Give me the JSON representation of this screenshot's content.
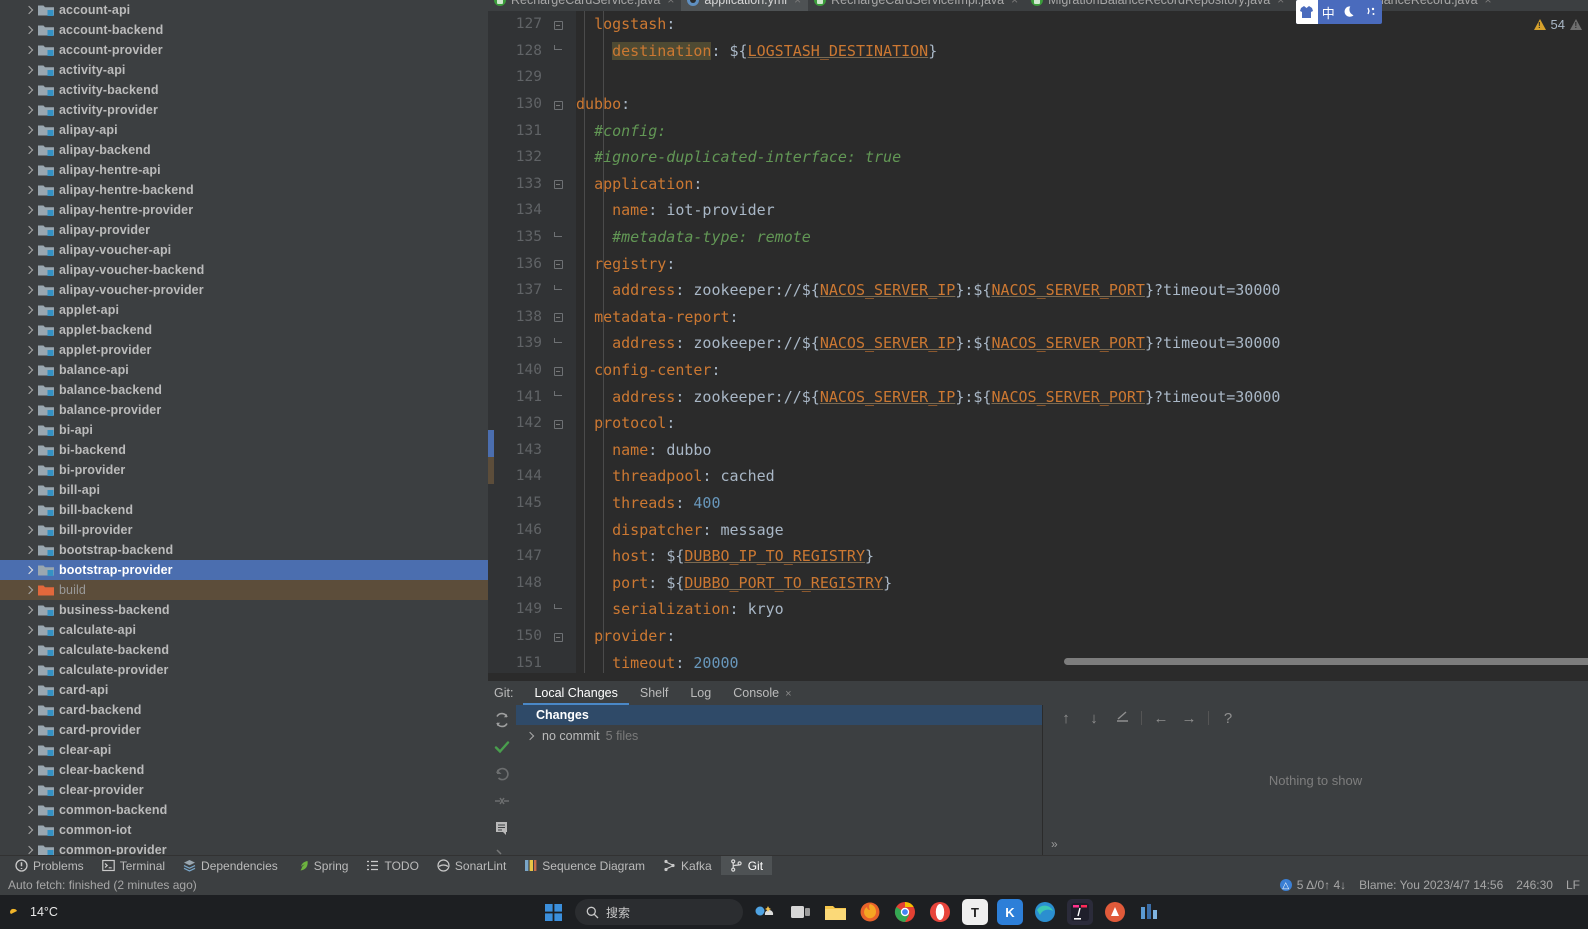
{
  "project_tree": {
    "items": [
      {
        "label": "account-api",
        "state": "normal"
      },
      {
        "label": "account-backend",
        "state": "normal"
      },
      {
        "label": "account-provider",
        "state": "normal"
      },
      {
        "label": "activity-api",
        "state": "normal"
      },
      {
        "label": "activity-backend",
        "state": "normal"
      },
      {
        "label": "activity-provider",
        "state": "normal"
      },
      {
        "label": "alipay-api",
        "state": "normal"
      },
      {
        "label": "alipay-backend",
        "state": "normal"
      },
      {
        "label": "alipay-hentre-api",
        "state": "normal"
      },
      {
        "label": "alipay-hentre-backend",
        "state": "normal"
      },
      {
        "label": "alipay-hentre-provider",
        "state": "normal"
      },
      {
        "label": "alipay-provider",
        "state": "normal"
      },
      {
        "label": "alipay-voucher-api",
        "state": "normal"
      },
      {
        "label": "alipay-voucher-backend",
        "state": "normal"
      },
      {
        "label": "alipay-voucher-provider",
        "state": "normal"
      },
      {
        "label": "applet-api",
        "state": "normal"
      },
      {
        "label": "applet-backend",
        "state": "normal"
      },
      {
        "label": "applet-provider",
        "state": "normal"
      },
      {
        "label": "balance-api",
        "state": "normal"
      },
      {
        "label": "balance-backend",
        "state": "normal"
      },
      {
        "label": "balance-provider",
        "state": "normal"
      },
      {
        "label": "bi-api",
        "state": "normal"
      },
      {
        "label": "bi-backend",
        "state": "normal"
      },
      {
        "label": "bi-provider",
        "state": "normal"
      },
      {
        "label": "bill-api",
        "state": "normal"
      },
      {
        "label": "bill-backend",
        "state": "normal"
      },
      {
        "label": "bill-provider",
        "state": "normal"
      },
      {
        "label": "bootstrap-backend",
        "state": "normal"
      },
      {
        "label": "bootstrap-provider",
        "state": "selected"
      },
      {
        "label": "build",
        "state": "excluded"
      },
      {
        "label": "business-backend",
        "state": "normal"
      },
      {
        "label": "calculate-api",
        "state": "normal"
      },
      {
        "label": "calculate-backend",
        "state": "normal"
      },
      {
        "label": "calculate-provider",
        "state": "normal"
      },
      {
        "label": "card-api",
        "state": "normal"
      },
      {
        "label": "card-backend",
        "state": "normal"
      },
      {
        "label": "card-provider",
        "state": "normal"
      },
      {
        "label": "clear-api",
        "state": "normal"
      },
      {
        "label": "clear-backend",
        "state": "normal"
      },
      {
        "label": "clear-provider",
        "state": "normal"
      },
      {
        "label": "common-backend",
        "state": "normal"
      },
      {
        "label": "common-iot",
        "state": "normal"
      },
      {
        "label": "common-provider",
        "state": "normal"
      }
    ]
  },
  "editor": {
    "tabs": [
      {
        "label": "RechargeCardService.java",
        "icon": "java-class-icon",
        "active": false
      },
      {
        "label": "application.yml",
        "icon": "yaml-file-icon",
        "active": true
      },
      {
        "label": "RechargeCardServiceImpl.java",
        "icon": "java-class-icon",
        "active": false
      },
      {
        "label": "MigrationBalanceRecordRepository.java",
        "icon": "java-class-icon",
        "active": false
      },
      {
        "label": "MigrationBalanceRecord.java",
        "icon": "java-class-icon",
        "active": false
      }
    ],
    "inspection": {
      "warning_count": "54"
    },
    "first_line_number": 127,
    "lines": [
      {
        "n": 127,
        "fold": "box",
        "indent": 2,
        "tokens": [
          {
            "t": "logstash",
            "c": "k"
          },
          {
            "t": ":",
            "c": "pn"
          }
        ]
      },
      {
        "n": 128,
        "fold": "arm",
        "indent": 4,
        "tokens": [
          {
            "t": "destination",
            "c": "k hl"
          },
          {
            "t": ":",
            "c": "pn"
          },
          {
            "t": " ",
            "c": "v"
          },
          {
            "t": "${",
            "c": "pn"
          },
          {
            "t": "LOGSTASH_DESTINATION",
            "c": "mac"
          },
          {
            "t": "}",
            "c": "pn"
          }
        ]
      },
      {
        "n": 129,
        "fold": "",
        "indent": 0,
        "tokens": []
      },
      {
        "n": 130,
        "fold": "box",
        "indent": 0,
        "tokens": [
          {
            "t": "dubbo",
            "c": "k"
          },
          {
            "t": ":",
            "c": "pn"
          }
        ]
      },
      {
        "n": 131,
        "fold": "",
        "indent": 2,
        "tokens": [
          {
            "t": "#config:",
            "c": "cm"
          }
        ]
      },
      {
        "n": 132,
        "fold": "",
        "indent": 2,
        "tokens": [
          {
            "t": "#ignore-duplicated-interface: true",
            "c": "cm"
          }
        ]
      },
      {
        "n": 133,
        "fold": "box",
        "indent": 2,
        "tokens": [
          {
            "t": "application",
            "c": "k"
          },
          {
            "t": ":",
            "c": "pn"
          }
        ]
      },
      {
        "n": 134,
        "fold": "",
        "indent": 4,
        "tokens": [
          {
            "t": "name",
            "c": "k"
          },
          {
            "t": ": ",
            "c": "pn"
          },
          {
            "t": "iot-provider",
            "c": "v"
          }
        ]
      },
      {
        "n": 135,
        "fold": "arm",
        "indent": 4,
        "tokens": [
          {
            "t": "#metadata-type: remote",
            "c": "cm"
          }
        ]
      },
      {
        "n": 136,
        "fold": "box",
        "indent": 2,
        "tokens": [
          {
            "t": "registry",
            "c": "k"
          },
          {
            "t": ":",
            "c": "pn"
          }
        ]
      },
      {
        "n": 137,
        "fold": "arm",
        "indent": 4,
        "tokens": [
          {
            "t": "address",
            "c": "k"
          },
          {
            "t": ": ",
            "c": "pn"
          },
          {
            "t": "zookeeper://",
            "c": "v"
          },
          {
            "t": "${",
            "c": "pn"
          },
          {
            "t": "NACOS_SERVER_IP",
            "c": "mac"
          },
          {
            "t": "}",
            "c": "pn"
          },
          {
            "t": ":",
            "c": "v"
          },
          {
            "t": "${",
            "c": "pn"
          },
          {
            "t": "NACOS_SERVER_PORT",
            "c": "mac"
          },
          {
            "t": "}",
            "c": "pn"
          },
          {
            "t": "?timeout=30000",
            "c": "v"
          }
        ]
      },
      {
        "n": 138,
        "fold": "box",
        "indent": 2,
        "tokens": [
          {
            "t": "metadata-report",
            "c": "k"
          },
          {
            "t": ":",
            "c": "pn"
          }
        ]
      },
      {
        "n": 139,
        "fold": "arm",
        "indent": 4,
        "tokens": [
          {
            "t": "address",
            "c": "k"
          },
          {
            "t": ": ",
            "c": "pn"
          },
          {
            "t": "zookeeper://",
            "c": "v"
          },
          {
            "t": "${",
            "c": "pn"
          },
          {
            "t": "NACOS_SERVER_IP",
            "c": "mac"
          },
          {
            "t": "}",
            "c": "pn"
          },
          {
            "t": ":",
            "c": "v"
          },
          {
            "t": "${",
            "c": "pn"
          },
          {
            "t": "NACOS_SERVER_PORT",
            "c": "mac"
          },
          {
            "t": "}",
            "c": "pn"
          },
          {
            "t": "?timeout=30000",
            "c": "v"
          }
        ]
      },
      {
        "n": 140,
        "fold": "box",
        "indent": 2,
        "tokens": [
          {
            "t": "config-center",
            "c": "k"
          },
          {
            "t": ":",
            "c": "pn"
          }
        ]
      },
      {
        "n": 141,
        "fold": "arm",
        "indent": 4,
        "tokens": [
          {
            "t": "address",
            "c": "k"
          },
          {
            "t": ": ",
            "c": "pn"
          },
          {
            "t": "zookeeper://",
            "c": "v"
          },
          {
            "t": "${",
            "c": "pn"
          },
          {
            "t": "NACOS_SERVER_IP",
            "c": "mac"
          },
          {
            "t": "}",
            "c": "pn"
          },
          {
            "t": ":",
            "c": "v"
          },
          {
            "t": "${",
            "c": "pn"
          },
          {
            "t": "NACOS_SERVER_PORT",
            "c": "mac"
          },
          {
            "t": "}",
            "c": "pn"
          },
          {
            "t": "?timeout=30000",
            "c": "v"
          }
        ]
      },
      {
        "n": 142,
        "fold": "box",
        "indent": 2,
        "tokens": [
          {
            "t": "protocol",
            "c": "k"
          },
          {
            "t": ":",
            "c": "pn"
          }
        ]
      },
      {
        "n": 143,
        "fold": "",
        "indent": 4,
        "tokens": [
          {
            "t": "name",
            "c": "k"
          },
          {
            "t": ": ",
            "c": "pn"
          },
          {
            "t": "dubbo",
            "c": "v"
          }
        ]
      },
      {
        "n": 144,
        "fold": "",
        "indent": 4,
        "tokens": [
          {
            "t": "threadpool",
            "c": "k"
          },
          {
            "t": ": ",
            "c": "pn"
          },
          {
            "t": "cached",
            "c": "v"
          }
        ]
      },
      {
        "n": 145,
        "fold": "",
        "indent": 4,
        "tokens": [
          {
            "t": "threads",
            "c": "k"
          },
          {
            "t": ": ",
            "c": "pn"
          },
          {
            "t": "400",
            "c": "num"
          }
        ]
      },
      {
        "n": 146,
        "fold": "",
        "indent": 4,
        "tokens": [
          {
            "t": "dispatcher",
            "c": "k"
          },
          {
            "t": ": ",
            "c": "pn"
          },
          {
            "t": "message",
            "c": "v"
          }
        ]
      },
      {
        "n": 147,
        "fold": "",
        "indent": 4,
        "tokens": [
          {
            "t": "host",
            "c": "k"
          },
          {
            "t": ": ",
            "c": "pn"
          },
          {
            "t": "${",
            "c": "pn"
          },
          {
            "t": "DUBBO_IP_TO_REGISTRY",
            "c": "mac"
          },
          {
            "t": "}",
            "c": "pn"
          }
        ]
      },
      {
        "n": 148,
        "fold": "",
        "indent": 4,
        "tokens": [
          {
            "t": "port",
            "c": "k"
          },
          {
            "t": ": ",
            "c": "pn"
          },
          {
            "t": "${",
            "c": "pn"
          },
          {
            "t": "DUBBO_PORT_TO_REGISTRY",
            "c": "mac"
          },
          {
            "t": "}",
            "c": "pn"
          }
        ]
      },
      {
        "n": 149,
        "fold": "arm",
        "indent": 4,
        "tokens": [
          {
            "t": "serialization",
            "c": "k"
          },
          {
            "t": ": ",
            "c": "pn"
          },
          {
            "t": "kryo",
            "c": "v"
          }
        ]
      },
      {
        "n": 150,
        "fold": "box",
        "indent": 2,
        "tokens": [
          {
            "t": "provider",
            "c": "k"
          },
          {
            "t": ":",
            "c": "pn"
          }
        ]
      },
      {
        "n": 151,
        "fold": "",
        "indent": 4,
        "tokens": [
          {
            "t": "timeout",
            "c": "k"
          },
          {
            "t": ": ",
            "c": "pn"
          },
          {
            "t": "20000",
            "c": "num"
          }
        ]
      }
    ]
  },
  "ime_bar": {
    "items": [
      {
        "icon": "shirt-icon",
        "label": "👕"
      },
      {
        "icon": "chinese-input-icon",
        "label": "中"
      },
      {
        "icon": "moon-icon",
        "label": ""
      },
      {
        "icon": "sparkle-icon",
        "label": "˙̦"
      }
    ]
  },
  "git_panel": {
    "label": "Git:",
    "tabs": [
      {
        "label": "Local Changes",
        "active": true,
        "closable": false
      },
      {
        "label": "Shelf",
        "active": false,
        "closable": false
      },
      {
        "label": "Log",
        "active": false,
        "closable": false
      },
      {
        "label": "Console",
        "active": false,
        "closable": true
      }
    ],
    "close_glyph": "×",
    "changes_header": "Changes",
    "changelists": [
      {
        "name": "no commit",
        "count": "5 files"
      }
    ],
    "side_icons": [
      "refresh-icon",
      "commit-check-icon",
      "rollback-icon",
      "shelve-icon",
      "notes-icon",
      "collapse-icon"
    ],
    "right_toolbar": [
      "arrow-up-icon",
      "arrow-down-icon",
      "edit-icon",
      "arrow-left-icon",
      "arrow-right-icon",
      "help-icon"
    ],
    "right_empty_text": "Nothing to show",
    "expander_glyph": "»"
  },
  "tool_bar": {
    "buttons": [
      {
        "label": "Problems",
        "icon": "problems-icon",
        "active": false
      },
      {
        "label": "Terminal",
        "icon": "terminal-icon",
        "active": false
      },
      {
        "label": "Dependencies",
        "icon": "dependencies-icon",
        "active": false
      },
      {
        "label": "Spring",
        "icon": "spring-leaf-icon",
        "active": false
      },
      {
        "label": "TODO",
        "icon": "todo-list-icon",
        "active": false
      },
      {
        "label": "SonarLint",
        "icon": "sonarlint-icon",
        "active": false
      },
      {
        "label": "Sequence Diagram",
        "icon": "sequence-diagram-icon",
        "active": false
      },
      {
        "label": "Kafka",
        "icon": "kafka-icon",
        "active": false
      },
      {
        "label": "Git",
        "icon": "git-branch-icon",
        "active": true
      }
    ]
  },
  "status_bar": {
    "left_message": "Auto fetch: finished (2 minutes ago)",
    "vcs_changes": "5 Δ/0↑ 4↓",
    "blame": "Blame: You 2023/4/7 14:56",
    "caret_position": "246:30",
    "line_separator": "LF"
  },
  "taskbar": {
    "temperature": "14°C",
    "search_placeholder": "搜索",
    "apps": [
      {
        "name": "start-icon",
        "color": "#2a8ad4",
        "glyph": ""
      },
      {
        "name": "weather-widget-icon",
        "color": "transparent",
        "glyph": "🌤"
      },
      {
        "name": "task-view-icon",
        "color": "#c9c9c9",
        "glyph": ""
      },
      {
        "name": "file-explorer-icon",
        "color": "#f5c148",
        "glyph": ""
      },
      {
        "name": "firefox-icon",
        "color": "#e8622a",
        "glyph": ""
      },
      {
        "name": "chrome-icon",
        "color": "#e34133",
        "glyph": ""
      },
      {
        "name": "opera-icon",
        "color": "#e8453c",
        "glyph": ""
      },
      {
        "name": "typora-icon",
        "color": "#efefef",
        "glyph": "T"
      },
      {
        "name": "kugou-icon",
        "color": "#2d7fd8",
        "glyph": "K"
      },
      {
        "name": "edge-icon",
        "color": "#37a6e0",
        "glyph": ""
      },
      {
        "name": "intellij-idea-icon",
        "color": "#2b2b3a",
        "glyph": ""
      },
      {
        "name": "app-icon-a",
        "color": "#e05a3a",
        "glyph": ""
      },
      {
        "name": "app-icon-b",
        "color": "#3b6ea8",
        "glyph": ""
      }
    ]
  }
}
